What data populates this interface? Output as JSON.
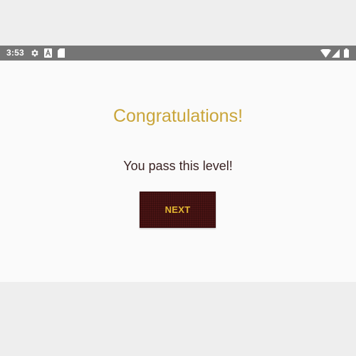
{
  "status_bar": {
    "time": "3:53",
    "left_icons": [
      "settings-icon",
      "a-notification-icon",
      "sd-card-icon"
    ],
    "right_icons": [
      "wifi-icon",
      "cell-signal-icon",
      "battery-icon"
    ]
  },
  "congrats": {
    "title": "Congratulations!",
    "message": "You pass this level!",
    "next_label": "NEXT"
  },
  "colors": {
    "title": "#c9a53a",
    "message": "#3a2424",
    "button_bg": "#4a1414",
    "button_text": "#e2b631",
    "status_bar": "#757575",
    "screen_bg": "#fafafa",
    "page_bg": "#eeeeee"
  }
}
